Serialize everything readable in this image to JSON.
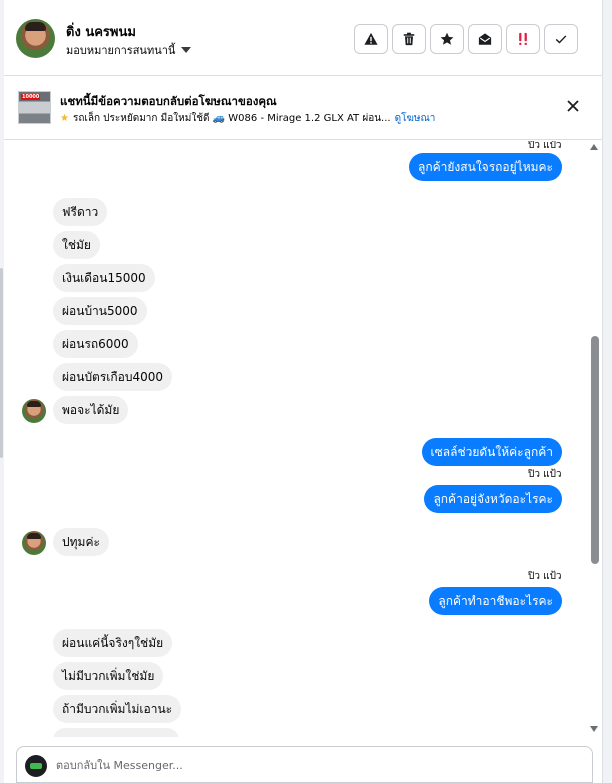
{
  "contact": {
    "name": "ดิ่ง นครพนม",
    "assign_label": "มอบหมายการสนทนานี้"
  },
  "toolbar": {
    "icons": [
      "warning-icon",
      "trash-icon",
      "star-icon",
      "open-envelope-icon",
      "urgent-icon",
      "check-icon"
    ]
  },
  "ad": {
    "title": "แชทนี้มีข้อความตอบกลับต่อโฆษณาของคุณ",
    "description": "รถเล็ก ประหยัดมาก มือใหม่ใช้ดี 🚙 W086 - Mirage 1.2 GLX AT ผ่อน...",
    "link": "ดูโฆษณา",
    "thumb_tag": "10000"
  },
  "conversation": {
    "messages": [
      {
        "type": "seen",
        "text": "ปิว แป้ว"
      },
      {
        "type": "out",
        "text": "ลูกค้ายังสนใจรถอยู่ไหมคะ"
      },
      {
        "type": "in",
        "text": "ฟรีดาว"
      },
      {
        "type": "in",
        "text": "ใช่มัย"
      },
      {
        "type": "in",
        "text": "เงินเดือน15000"
      },
      {
        "type": "in",
        "text": "ผ่อนบ้าน5000"
      },
      {
        "type": "in",
        "text": "ผ่อนรถ6000"
      },
      {
        "type": "in",
        "text": "ผ่อนบัตรเกือบ4000"
      },
      {
        "type": "in",
        "text": "พอจะได้มัย"
      },
      {
        "type": "out",
        "text": "เซลล์ช่วยดันให้ค่ะลูกค้า"
      },
      {
        "type": "seen",
        "text": "ปิว แป้ว"
      },
      {
        "type": "out",
        "text": "ลูกค้าอยู่จังหวัดอะไรคะ"
      },
      {
        "type": "in",
        "text": "ปทุมค่ะ"
      },
      {
        "type": "seen",
        "text": "ปิว แป้ว"
      },
      {
        "type": "out",
        "text": "ลูกค้าทำอาชีพอะไรคะ"
      },
      {
        "type": "in",
        "text": "ผ่อนแค่นี้จริงๆใช่มัย"
      },
      {
        "type": "in",
        "text": "ไม่มีบวกเพิ่มใช่มัย"
      },
      {
        "type": "in",
        "text": "ถ้ามีบวกเพิ่มไม่เอานะ"
      }
    ]
  },
  "composer": {
    "placeholder": "ตอบกลับใน Messenger..."
  },
  "colors": {
    "outgoing_bubble": "#0a7cff",
    "incoming_bubble": "#f0f0f0",
    "link": "#0064d1"
  }
}
